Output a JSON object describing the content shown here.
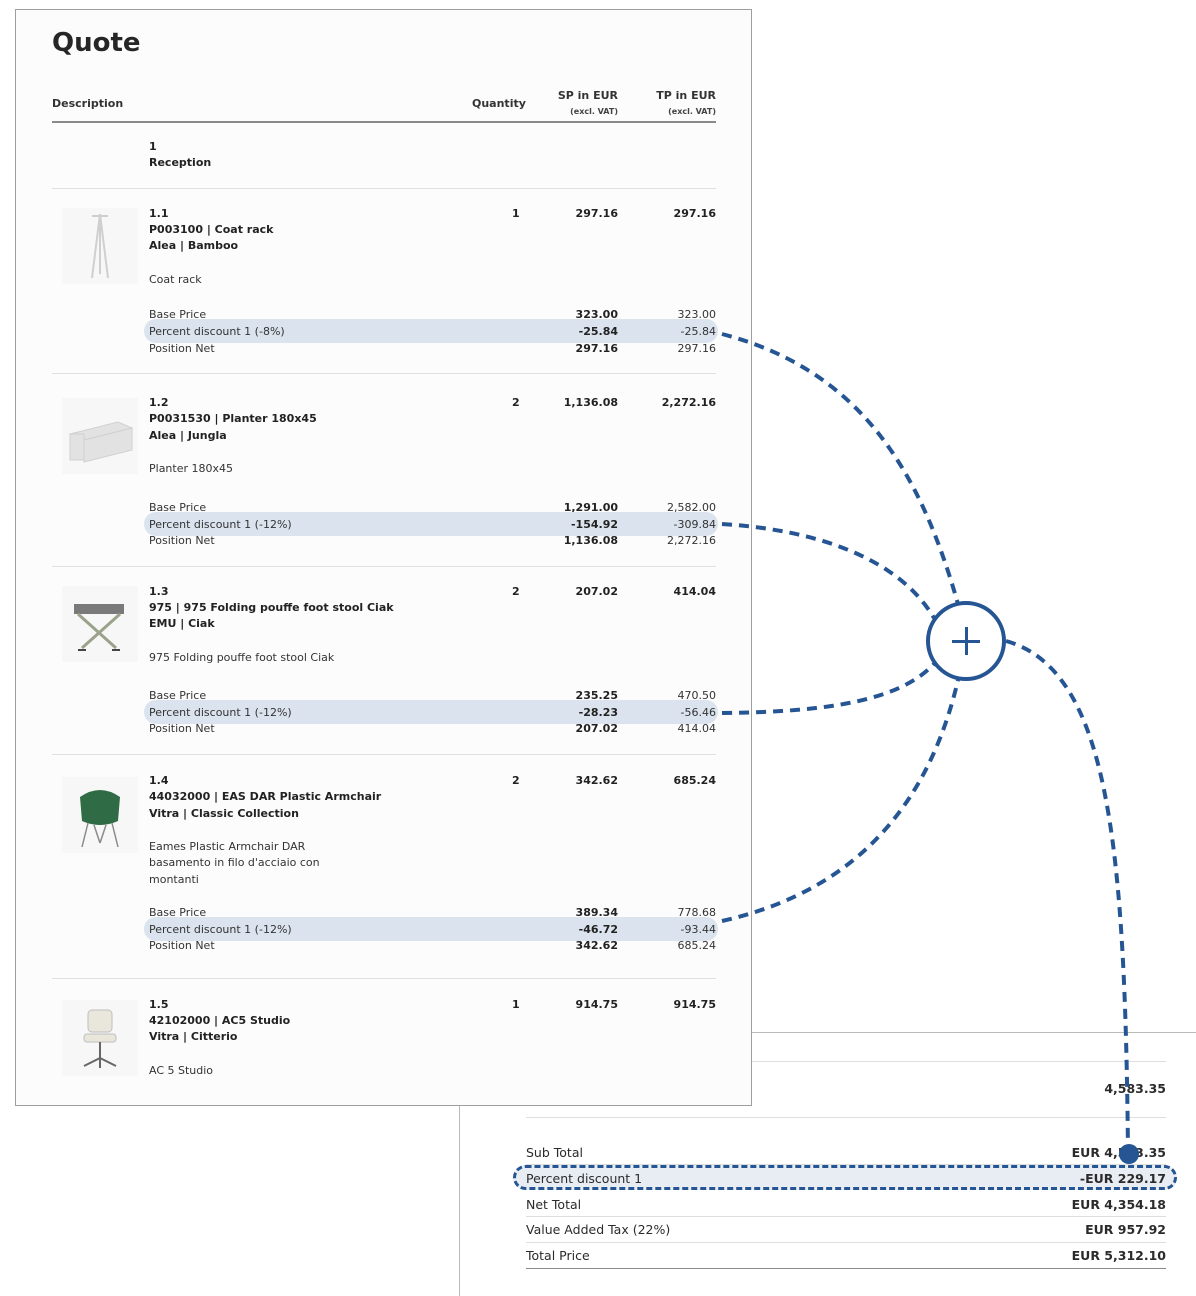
{
  "quote": {
    "title": "Quote",
    "headers": {
      "description": "Description",
      "quantity": "Quantity",
      "sp": "SP in EUR",
      "sp_sub": "(excl. VAT)",
      "tp": "TP in EUR",
      "tp_sub": "(excl. VAT)"
    },
    "section": {
      "number": "1",
      "name": "Reception"
    },
    "positions": [
      {
        "number": "1.1",
        "code_line": "P003100 | Coat rack",
        "brand_line": "Alea | Bamboo",
        "description": [
          "Coat rack"
        ],
        "quantity": "1",
        "sp": "297.16",
        "tp": "297.16",
        "image": "coat-rack-image",
        "base_label": "Base Price",
        "base_sp": "323.00",
        "base_tp": "323.00",
        "discount_label": "Percent discount 1 (-8%)",
        "discount_sp": "-25.84",
        "discount_tp": "-25.84",
        "net_label": "Position Net",
        "net_sp": "297.16",
        "net_tp": "297.16"
      },
      {
        "number": "1.2",
        "code_line": "P0031530 | Planter 180x45",
        "brand_line": "Alea | Jungla",
        "description": [
          "Planter 180x45"
        ],
        "quantity": "2",
        "sp": "1,136.08",
        "tp": "2,272.16",
        "image": "planter-image",
        "base_label": "Base Price",
        "base_sp": "1,291.00",
        "base_tp": "2,582.00",
        "discount_label": "Percent discount 1 (-12%)",
        "discount_sp": "-154.92",
        "discount_tp": "-309.84",
        "net_label": "Position Net",
        "net_sp": "1,136.08",
        "net_tp": "2,272.16"
      },
      {
        "number": "1.3",
        "code_line": "975 | 975 Folding pouffe foot stool Ciak",
        "brand_line": "EMU | Ciak",
        "description": [
          "975 Folding pouffe foot stool Ciak"
        ],
        "quantity": "2",
        "sp": "207.02",
        "tp": "414.04",
        "image": "folding-stool-image",
        "base_label": "Base Price",
        "base_sp": "235.25",
        "base_tp": "470.50",
        "discount_label": "Percent discount 1 (-12%)",
        "discount_sp": "-28.23",
        "discount_tp": "-56.46",
        "net_label": "Position Net",
        "net_sp": "207.02",
        "net_tp": "414.04"
      },
      {
        "number": "1.4",
        "code_line": "44032000 | EAS DAR Plastic Armchair",
        "brand_line": "Vitra | Classic Collection",
        "description": [
          "Eames Plastic Armchair DAR",
          "basamento in filo d'acciaio con",
          "montanti"
        ],
        "quantity": "2",
        "sp": "342.62",
        "tp": "685.24",
        "image": "armchair-image",
        "base_label": "Base Price",
        "base_sp": "389.34",
        "base_tp": "778.68",
        "discount_label": "Percent discount 1 (-12%)",
        "discount_sp": "-46.72",
        "discount_tp": "-93.44",
        "net_label": "Position Net",
        "net_sp": "342.62",
        "net_tp": "685.24"
      },
      {
        "number": "1.5",
        "code_line": "42102000 | AC5 Studio",
        "brand_line": "Vitra | Citterio",
        "description": [
          "AC 5 Studio"
        ],
        "quantity": "1",
        "sp": "914.75",
        "tp": "914.75",
        "image": "office-chair-image"
      }
    ]
  },
  "summary": {
    "section_total": "4,583.35",
    "rows": [
      {
        "label": "Sub Total",
        "value": "EUR 4,583.35"
      },
      {
        "label": "Percent discount 1",
        "value": "-EUR 229.17"
      },
      {
        "label": "Net Total",
        "value": "EUR 4,354.18"
      },
      {
        "label": "Value Added Tax (22%)",
        "value": "EUR 957.92"
      },
      {
        "label": "Total Price",
        "value": "EUR 5,312.10"
      }
    ]
  },
  "colors": {
    "accent": "#265594",
    "highlight": "#dbe4ee"
  },
  "icons": {
    "add_button": "plus-icon"
  }
}
